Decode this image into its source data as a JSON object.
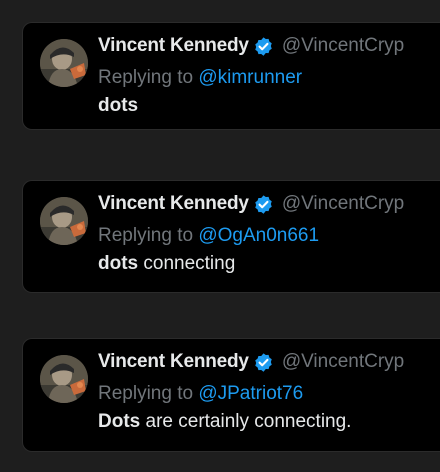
{
  "colors": {
    "page_bg": "#1e1e1e",
    "card_bg": "#000000",
    "name": "#e7e9ea",
    "muted": "#71767b",
    "mention": "#1d9bf0",
    "verified": "#1d9bf0"
  },
  "tweets": [
    {
      "name": "Vincent Kennedy",
      "handle": "@VincentCryp",
      "reply_prefix": "Replying to",
      "reply_to": "@kimrunner",
      "text_bold": "dots",
      "text_rest": ""
    },
    {
      "name": "Vincent Kennedy",
      "handle": "@VincentCryp",
      "reply_prefix": "Replying to",
      "reply_to": "@OgAn0n661",
      "text_bold": "dots",
      "text_rest": " connecting"
    },
    {
      "name": "Vincent Kennedy",
      "handle": "@VincentCryp",
      "reply_prefix": "Replying to",
      "reply_to": "@JPatriot76",
      "text_bold": "Dots",
      "text_rest": " are certainly connecting."
    }
  ],
  "icons": {
    "verified": "verified-badge-icon",
    "avatar": "profile-avatar"
  }
}
